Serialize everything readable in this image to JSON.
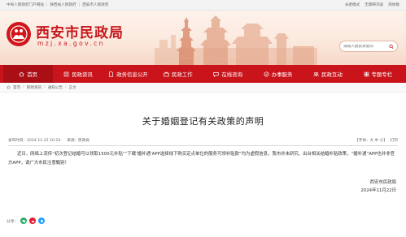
{
  "topbar": {
    "links": [
      "中央人民政府门户网站",
      "陕西省人民政府",
      "西安市人民政府"
    ],
    "right": [
      "长者模式",
      "无障碍浏览",
      "简体版"
    ]
  },
  "header": {
    "title": "西安市民政局",
    "domain": "mzj.xa.gov.cn",
    "search_placeholder": "请输入搜索关键词"
  },
  "nav": {
    "items": [
      {
        "label": "首页",
        "icon": "home-icon",
        "active": true
      },
      {
        "label": "民政资讯",
        "icon": "news-icon",
        "active": false
      },
      {
        "label": "政务信息公开",
        "icon": "document-icon",
        "active": false
      },
      {
        "label": "民政工作",
        "icon": "briefcase-icon",
        "active": false
      },
      {
        "label": "在线咨询",
        "icon": "chat-icon",
        "active": false
      },
      {
        "label": "办事服务",
        "icon": "service-icon",
        "active": false
      },
      {
        "label": "民政互动",
        "icon": "interact-icon",
        "active": false
      },
      {
        "label": "专题专栏",
        "icon": "topic-icon",
        "active": false
      }
    ]
  },
  "breadcrumb": [
    "首页",
    "民政资讯",
    "通知公告",
    "正文"
  ],
  "article": {
    "title": "关于婚姻登记有关政策的声明",
    "publish_time": "发布时间：2024-11-22 10:20",
    "source": "来源：民政局",
    "font_label": "【字体：大 中 小】",
    "print_label": "打印",
    "body": "近日，网络上流传“初次登记结婚可以领取1500元补贴”“下载‘婚补通’APP选择线下购买定点单位的服务可领补贴款”均为虚假信息，我市并未研究、出台相关结婚补贴政策，“婚补通”APP也并非官方APP，请广大市民注意甄别！",
    "signature": "西安市民政局",
    "date": "2024年11月22日"
  },
  "share": {
    "label": "分享：",
    "icons": [
      "wechat-icon",
      "weibo-icon",
      "qq-icon"
    ]
  },
  "colors": {
    "brand_red": "#c9141b",
    "active_nav": "#a90f15"
  }
}
